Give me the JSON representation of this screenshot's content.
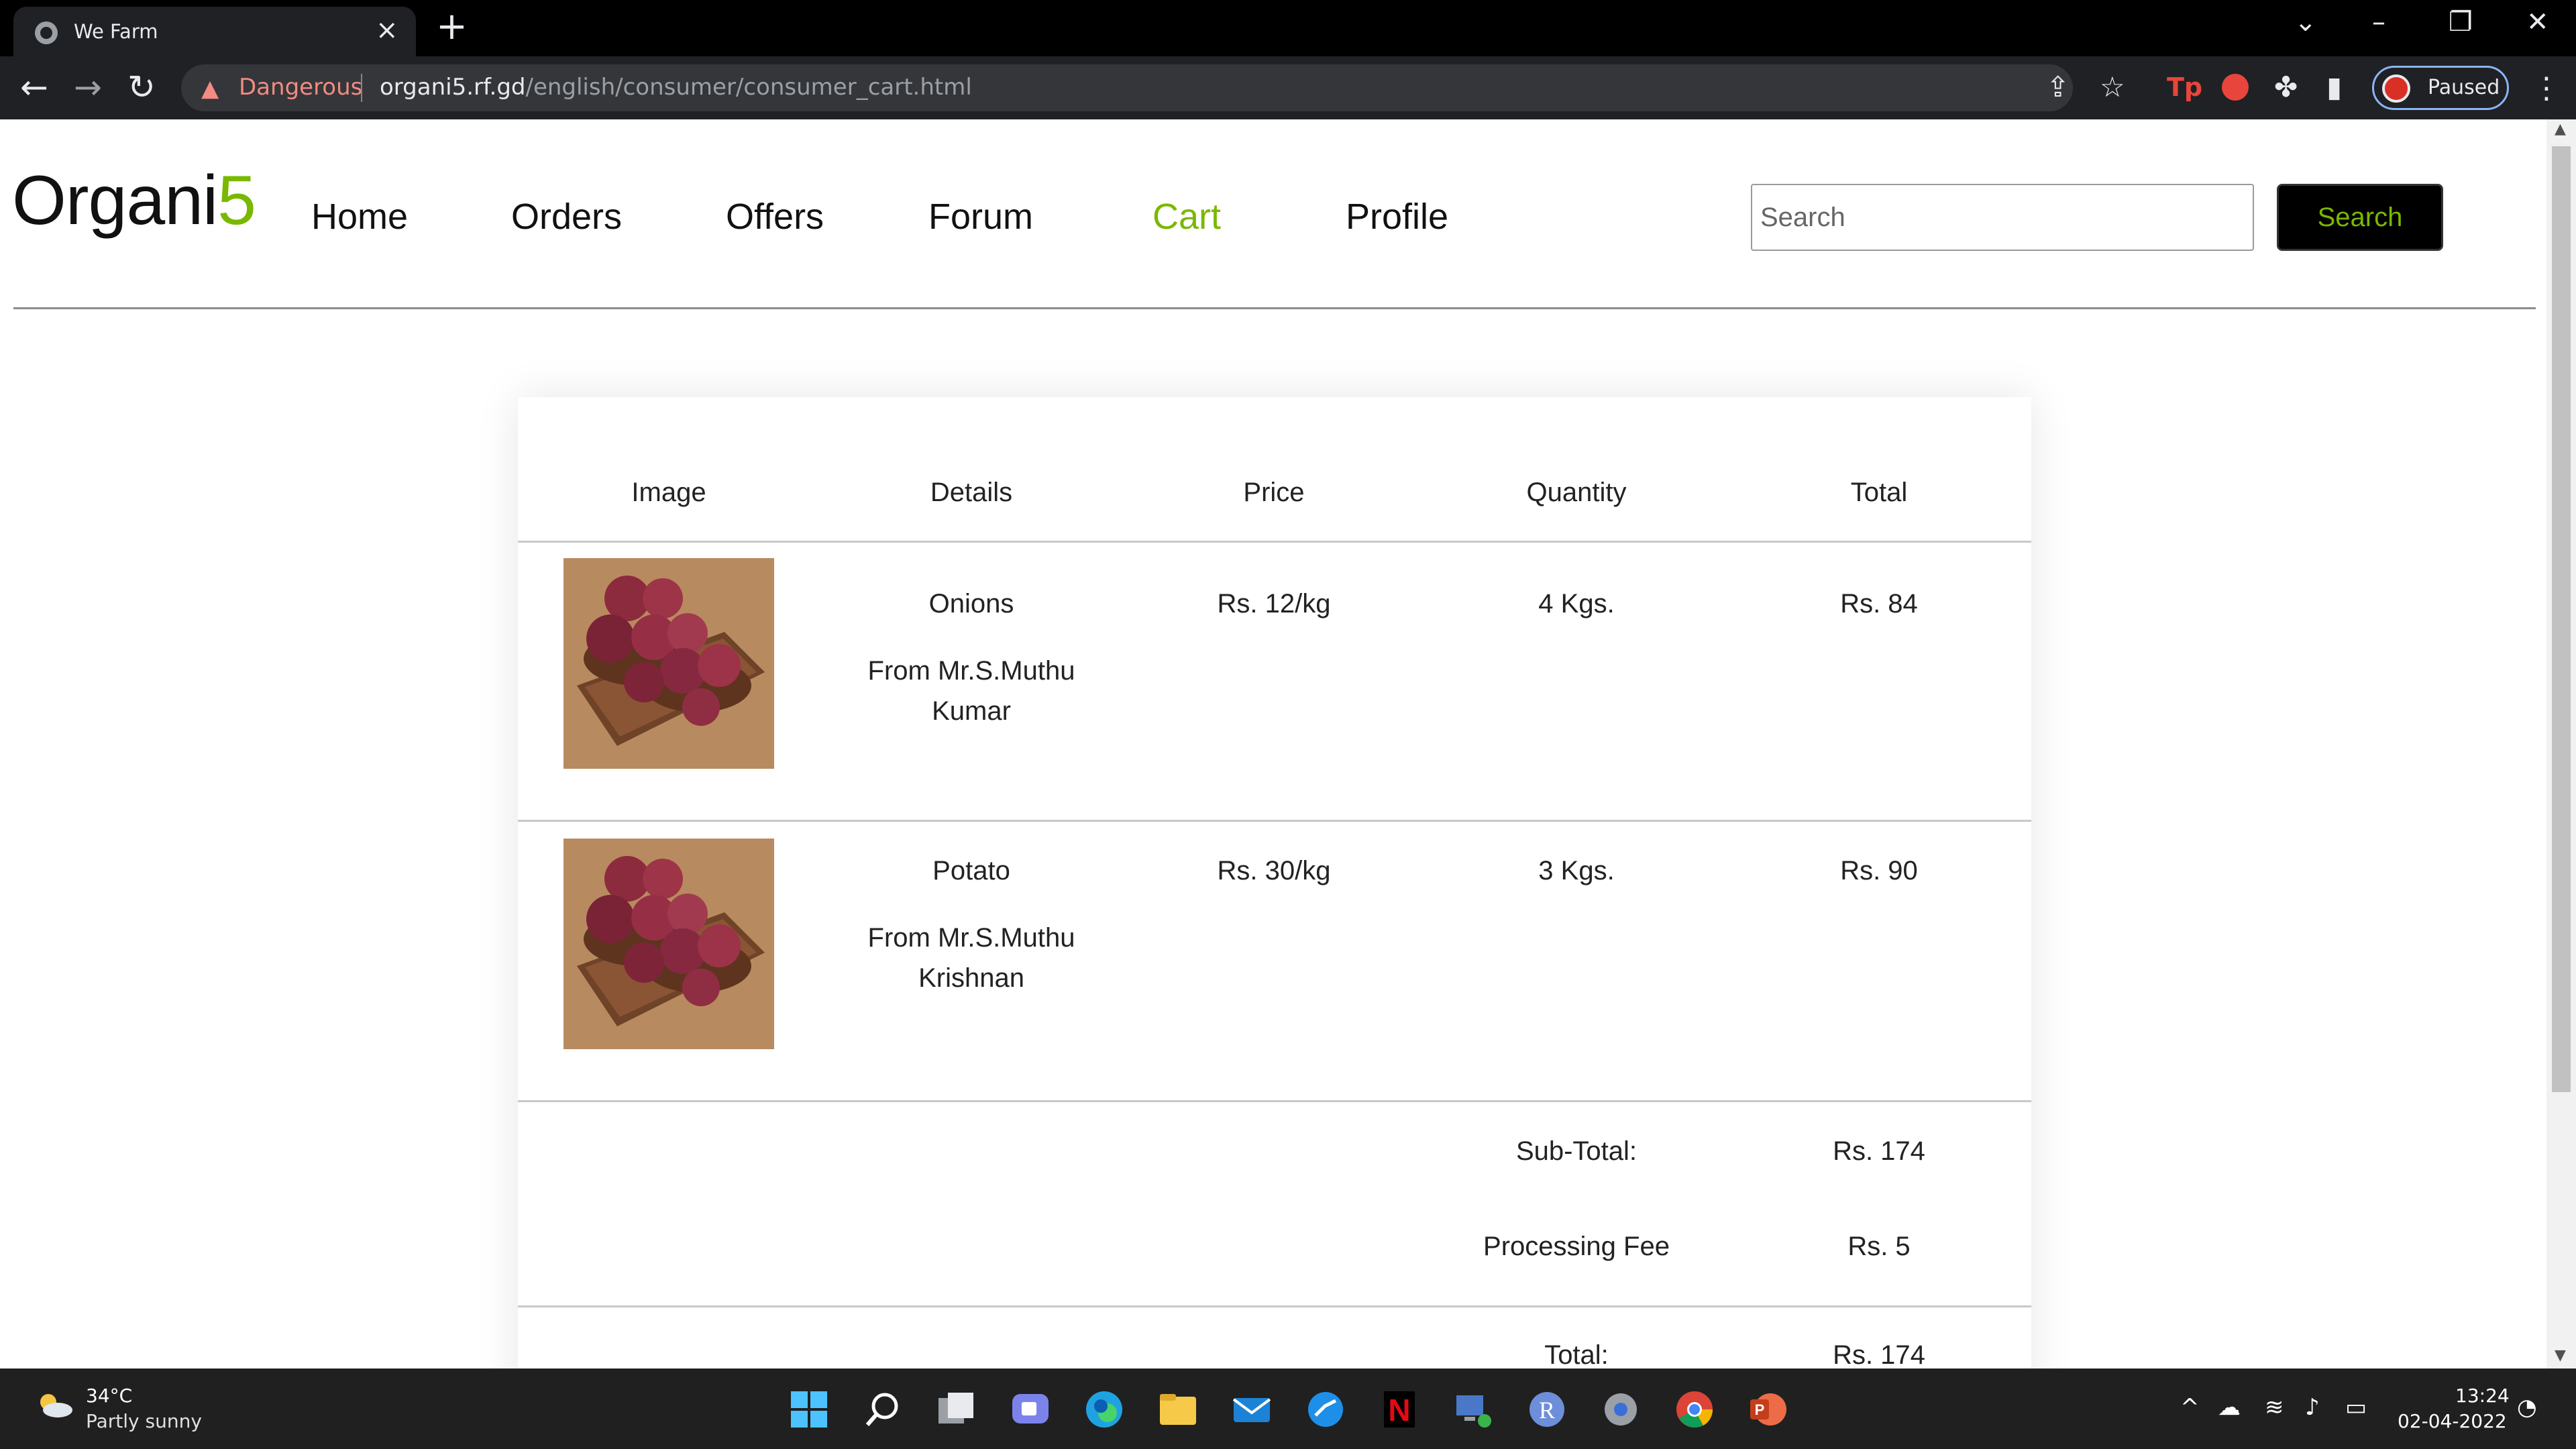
{
  "browser": {
    "tab_title": "We Farm",
    "security_label": "Dangerous",
    "url_host": "organi5.rf.gd",
    "url_path": "/english/consumer/consumer_cart.html",
    "profile_status": "Paused"
  },
  "site": {
    "logo_text": "Organi",
    "logo_accent": "5",
    "brand_color": "#7ab800",
    "nav": [
      "Home",
      "Orders",
      "Offers",
      "Forum",
      "Cart",
      "Profile"
    ],
    "active_nav": "Cart",
    "search_placeholder": "Search",
    "search_button": "Search"
  },
  "cart": {
    "headers": [
      "Image",
      "Details",
      "Price",
      "Quantity",
      "Total"
    ],
    "items": [
      {
        "name": "Onions",
        "seller_line1": "From Mr.S.Muthu",
        "seller_line2": "Kumar",
        "price": "Rs. 12/kg",
        "quantity": "4 Kgs.",
        "total": "Rs. 84"
      },
      {
        "name": "Potato",
        "seller_line1": "From Mr.S.Muthu",
        "seller_line2": "Krishnan",
        "price": "Rs. 30/kg",
        "quantity": "3 Kgs.",
        "total": "Rs. 90"
      }
    ],
    "subtotal_label": "Sub-Total:",
    "subtotal_value": "Rs. 174",
    "fee_label": "Processing Fee",
    "fee_value": "Rs. 5",
    "total_label": "Total:",
    "total_value": "Rs. 174"
  },
  "taskbar": {
    "temperature": "34°C",
    "condition": "Partly sunny",
    "time": "13:24",
    "date": "02-04-2022"
  }
}
